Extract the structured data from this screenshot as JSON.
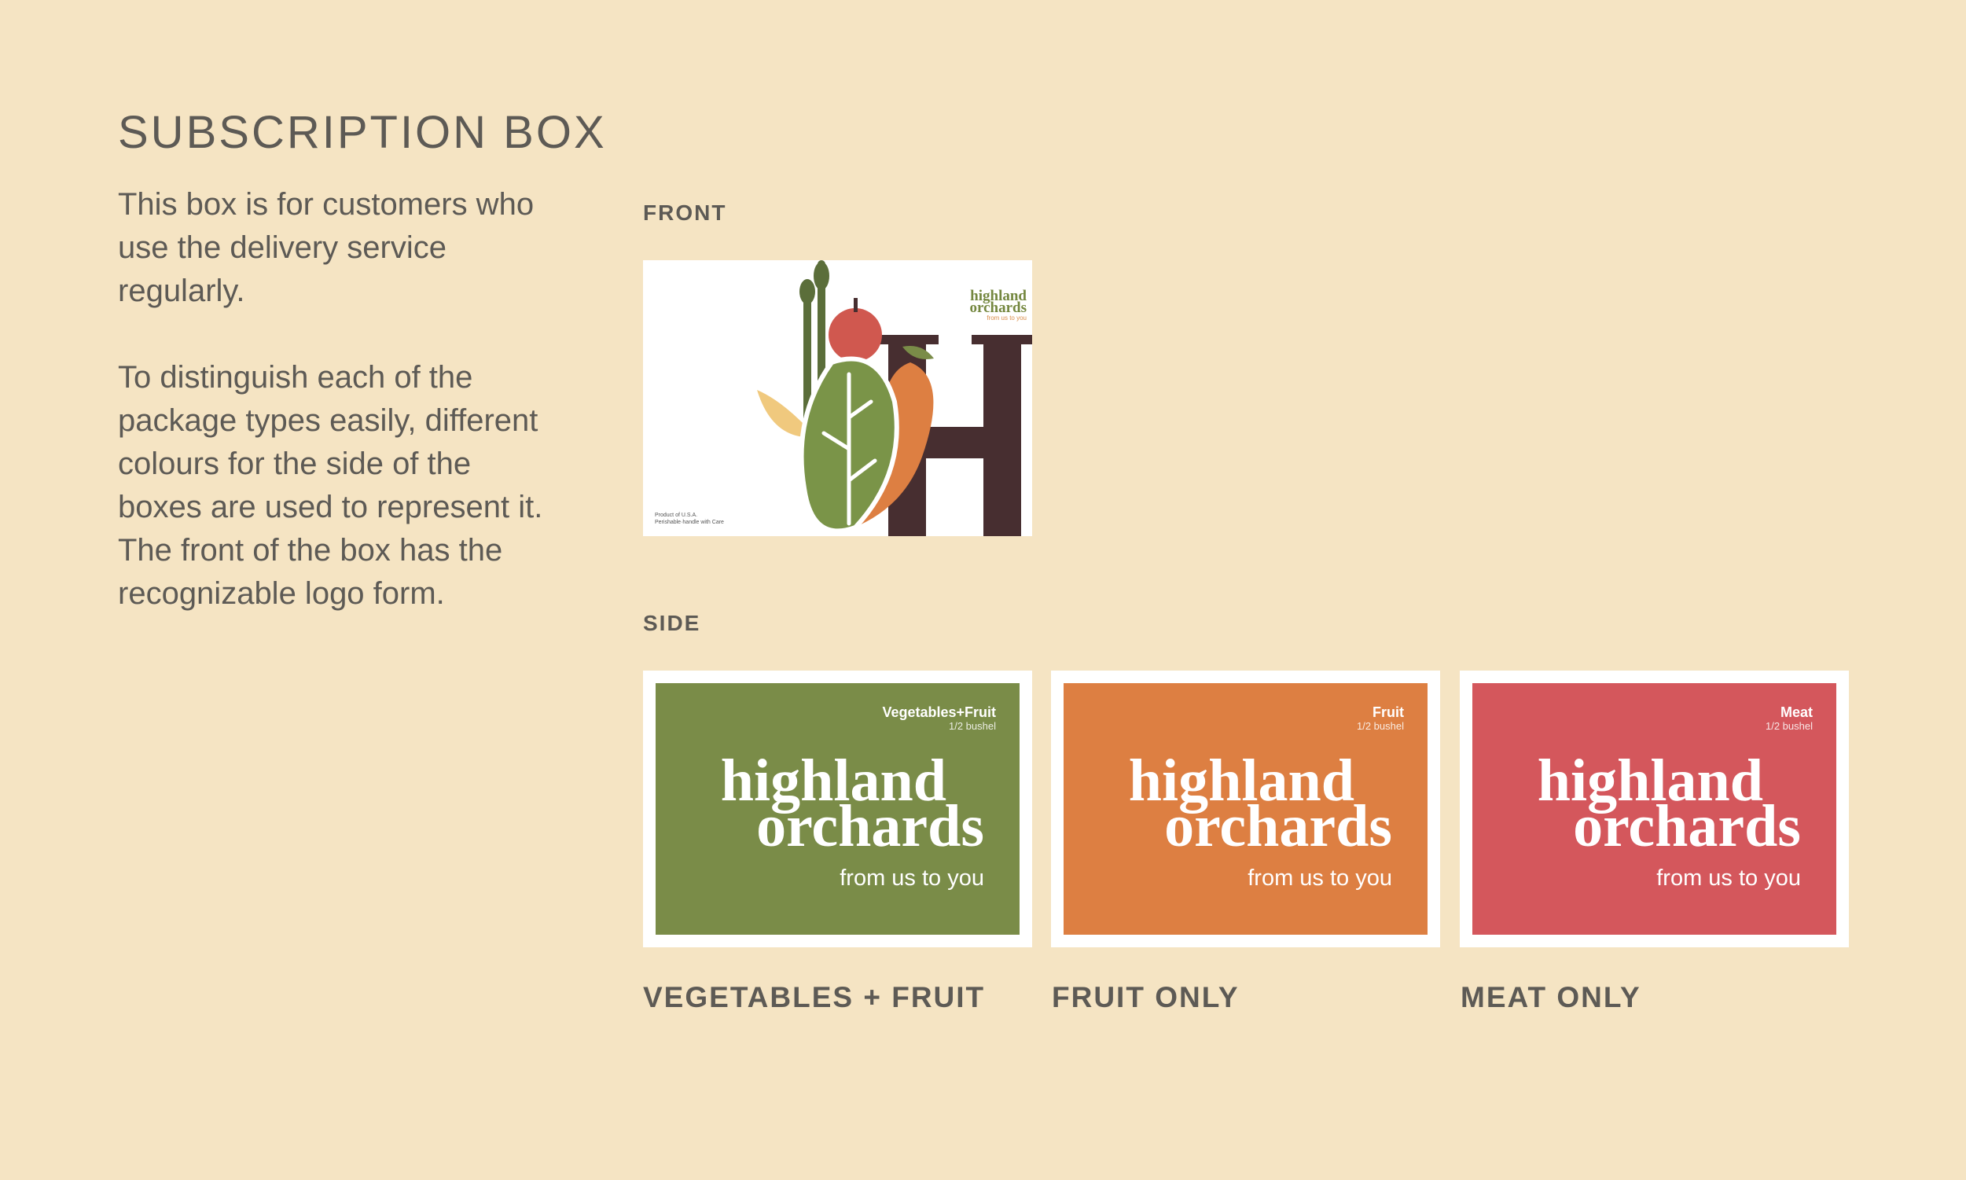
{
  "colors": {
    "background": "#f5e4c3",
    "text": "#5d5a55",
    "green": "#7a8c48",
    "orange": "#dd7f42",
    "red": "#d4575c",
    "dark_brown": "#472e30"
  },
  "header": {
    "title": "SUBSCRIPTION BOX"
  },
  "description": {
    "paragraph1": "This box is for customers who use the delivery service regularly.",
    "paragraph2": "To distinguish each of the package types easily, different colours for the side of the boxes are used to represent it. The front of the box has the recognizable logo form."
  },
  "front": {
    "label": "FRONT",
    "logo_line1": "highland",
    "logo_line2": "orchards",
    "logo_tag": "from us to you",
    "note_line1": "Product of U.S.A.",
    "note_line2": "Perishable·handle with Care"
  },
  "side": {
    "label": "SIDE",
    "cards": [
      {
        "type": "Vegetables+Fruit",
        "qty": "1/2 bushel",
        "brand_l1": "highland",
        "brand_l2": "orchards",
        "tagline": "from us to you",
        "color": "#7a8c48",
        "caption": "VEGETABLES + FRUIT"
      },
      {
        "type": "Fruit",
        "qty": "1/2 bushel",
        "brand_l1": "highland",
        "brand_l2": "orchards",
        "tagline": "from us to you",
        "color": "#dd7f42",
        "caption": "FRUIT ONLY"
      },
      {
        "type": "Meat",
        "qty": "1/2 bushel",
        "brand_l1": "highland",
        "brand_l2": "orchards",
        "tagline": "from us to you",
        "color": "#d4575c",
        "caption": "MEAT ONLY"
      }
    ]
  }
}
